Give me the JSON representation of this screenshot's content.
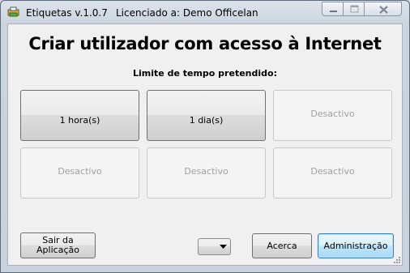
{
  "window": {
    "title": "Etiquetas v.1.0.7",
    "license": "Licenciado a: Demo Officelan"
  },
  "main": {
    "heading": "Criar utilizador com acesso à Internet",
    "subheading": "Limite de tempo pretendido:",
    "tiles": [
      {
        "label": "1 hora(s)",
        "enabled": true
      },
      {
        "label": "1 dia(s)",
        "enabled": true
      },
      {
        "label": "Desactivo",
        "enabled": false
      },
      {
        "label": "Desactivo",
        "enabled": false
      },
      {
        "label": "Desactivo",
        "enabled": false
      },
      {
        "label": "Desactivo",
        "enabled": false
      }
    ]
  },
  "footer": {
    "exit_label_1": "Sair da",
    "exit_label_2": "Aplicação",
    "dropdown_value": "",
    "about_label": "Acerca",
    "admin_label": "Administração"
  },
  "icons": {
    "app": "app-printer-icon",
    "minimize": "minimize-icon",
    "maximize": "maximize-icon",
    "close": "close-icon",
    "dropdown": "chevron-down-icon",
    "grip": "resize-grip-icon"
  }
}
